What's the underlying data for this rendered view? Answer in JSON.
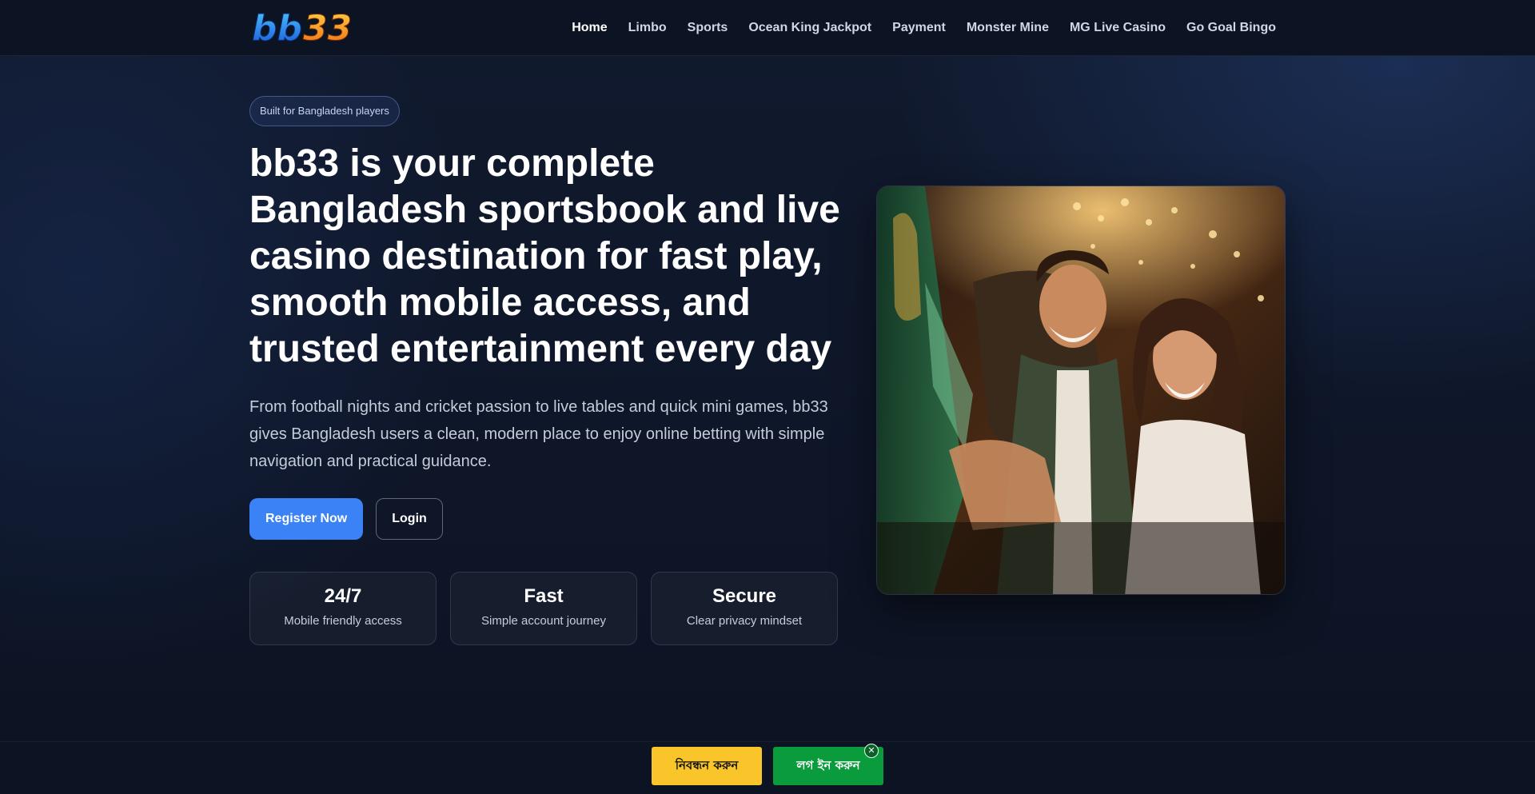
{
  "header": {
    "logo_text": "bb33",
    "nav": [
      {
        "label": "Home",
        "active": true
      },
      {
        "label": "Limbo"
      },
      {
        "label": "Sports"
      },
      {
        "label": "Ocean King Jackpot"
      },
      {
        "label": "Payment"
      },
      {
        "label": "Monster Mine"
      },
      {
        "label": "MG Live Casino"
      },
      {
        "label": "Go Goal Bingo"
      }
    ]
  },
  "hero": {
    "badge": "Built for Bangladesh players",
    "title": "bb33 is your complete Bangladesh sportsbook and live casino destination for fast play, smooth mobile access, and trusted entertainment every day",
    "lead": "From football nights and cricket passion to live tables and quick mini games, bb33 gives Bangladesh users a clean, modern place to enjoy online betting with simple navigation and practical guidance.",
    "register_label": "Register Now",
    "login_label": "Login",
    "stats": [
      {
        "value": "24/7",
        "label": "Mobile friendly access"
      },
      {
        "value": "Fast",
        "label": "Simple account journey"
      },
      {
        "value": "Secure",
        "label": "Clear privacy mindset"
      }
    ]
  },
  "sticky": {
    "register_label": "নিবন্ধন করুন",
    "login_label": "লগ ইন করুন",
    "close_label": "✕"
  },
  "colors": {
    "primary": "#3b82f6",
    "cta_yellow": "#f9c52b",
    "cta_green": "#0a9b3c",
    "background": "#0d1424"
  }
}
